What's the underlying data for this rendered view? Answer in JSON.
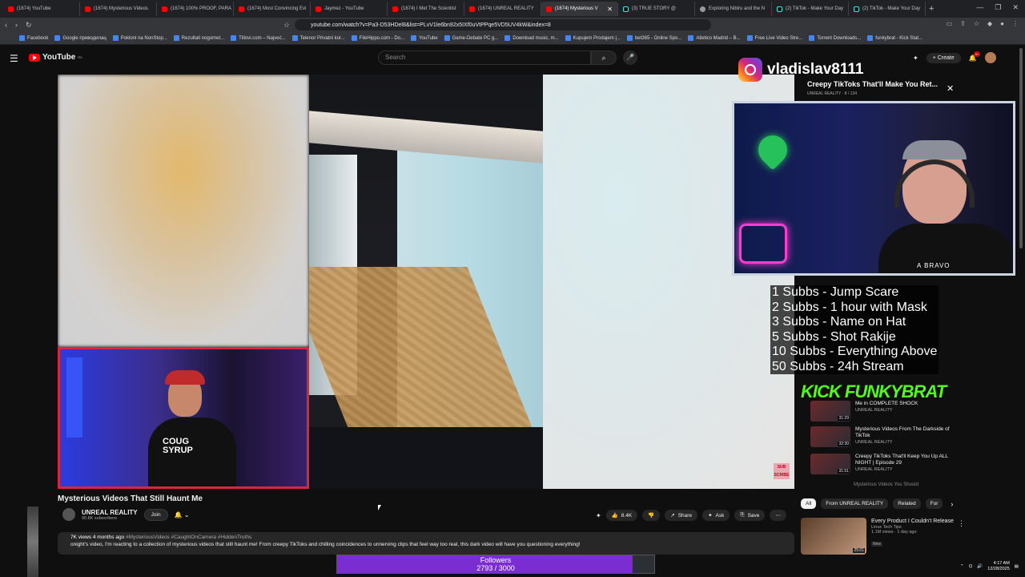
{
  "browser": {
    "tabs": [
      {
        "label": "(1674) YouTube",
        "icon": "youtube-icon"
      },
      {
        "label": "(1674) Mysterious Videos",
        "icon": "youtube-icon"
      },
      {
        "label": "(1674) 100% PROOF, PARA",
        "icon": "youtube-icon"
      },
      {
        "label": "(1674) Most Convincing Evi",
        "icon": "youtube-icon"
      },
      {
        "label": "Jaymez - YouTube",
        "icon": "youtube-icon"
      },
      {
        "label": "(1674) I Met The Scientist",
        "icon": "youtube-icon"
      },
      {
        "label": "(1674) UNREAL REALITY",
        "icon": "youtube-icon"
      },
      {
        "label": "(1674) Mysterious V",
        "icon": "youtube-icon",
        "active": true
      },
      {
        "label": "(3) TRUE STORY @",
        "icon": "tiktok-icon"
      },
      {
        "label": "Exploring Nibiru and the N",
        "icon": "globe-icon"
      },
      {
        "label": "(2) TikTok - Make Your Day",
        "icon": "tiktok-icon"
      },
      {
        "label": "(2) TikTok - Make Your Day",
        "icon": "tiktok-icon"
      }
    ],
    "url": "youtube.com/watch?v=Pa3-D53HDel8&list=PLvV1le6bn92x5IXf0uVtPPqe5VD5UV4kW&index=8",
    "bookmarks": [
      "Facebook",
      "Google преводилац",
      "Poklonі na NonStop...",
      "Rezultati nogomet...",
      "Titlovi.com – Najveć...",
      "Telenor Privatni kor...",
      "FileHippo.com - Do...",
      "YouTube",
      "Game-Debate PC g...",
      "Download music, m...",
      "Kupujem Prodajem |...",
      "bet365 - Online Spo...",
      "Atletico Madrid – B...",
      "Free Live Video Stre...",
      "Torrent Downloads...",
      "funkybrat - Kick Stat..."
    ]
  },
  "youtube": {
    "logo_text": "YouTube",
    "logo_region": "RS",
    "search_placeholder": "Search",
    "create_label": "Create",
    "notification_count": "9+"
  },
  "overlay": {
    "instagram_handle": "vladislav8111",
    "goals": [
      "1 Subbs - Jump Scare",
      "2 Subbs - 1 hour with Mask",
      "3 Subbs - Name on Hat",
      "5 Subbs - Shot Rakije",
      "10 Subbs - Everything Above",
      "50 Subbs - 24h Stream"
    ],
    "kick_logo": "KICK FUNKYBRAT",
    "followers_label": "Followers",
    "followers_text": "2793 / 3000",
    "followers_fraction": 0.931
  },
  "miniplayer": {
    "title": "Creepy TikToks That'll Make You Ret...",
    "sub": "UNREAL REALITY · 8 / 134"
  },
  "video": {
    "title": "Mysterious Videos That Still Haunt Me",
    "channel": "UNREAL REALITY",
    "subscribers": "90.8K subscribers",
    "join_label": "Join",
    "like_count": "8.4K",
    "share_label": "Share",
    "ask_label": "Ask",
    "save_label": "Save",
    "views_meta": "7K views  4 months ago",
    "hashtags": "#MysteriousVideos #CaughtOnCamera #HiddenTruths",
    "description": "onight's video, I'm reacting to a collection of mysterious videos that still haunt me! From creepy TikToks and chilling coincidences to unnerving clips that feel way too real, this dark video will have you questioning everything!"
  },
  "sidebar": {
    "recommendations": [
      {
        "title": "Me in COMPLETE SHOCK",
        "channel": "UNREAL REALITY",
        "duration": "31:29"
      },
      {
        "title": "Mysterious Videos From The Darkside of TikTok",
        "channel": "UNREAL REALITY",
        "duration": "32:30"
      },
      {
        "title": "Creepy TikToks That'll Keep You Up ALL NIGHT | Episode 29",
        "channel": "UNREAL REALITY",
        "duration": "31:51"
      }
    ],
    "last_fragment": "Mysterious Videos You Should",
    "chips": [
      "All",
      "From UNREAL REALITY",
      "Related",
      "For"
    ],
    "bottom_rec": {
      "title": "Every Product I Couldn't Release",
      "channel": "Linus Tech Tips",
      "meta": "1.1M views · 1 day ago",
      "badge": "New",
      "duration": "25:01"
    }
  },
  "tray": {
    "time": "4:17 AM",
    "date": "12/28/2025"
  }
}
